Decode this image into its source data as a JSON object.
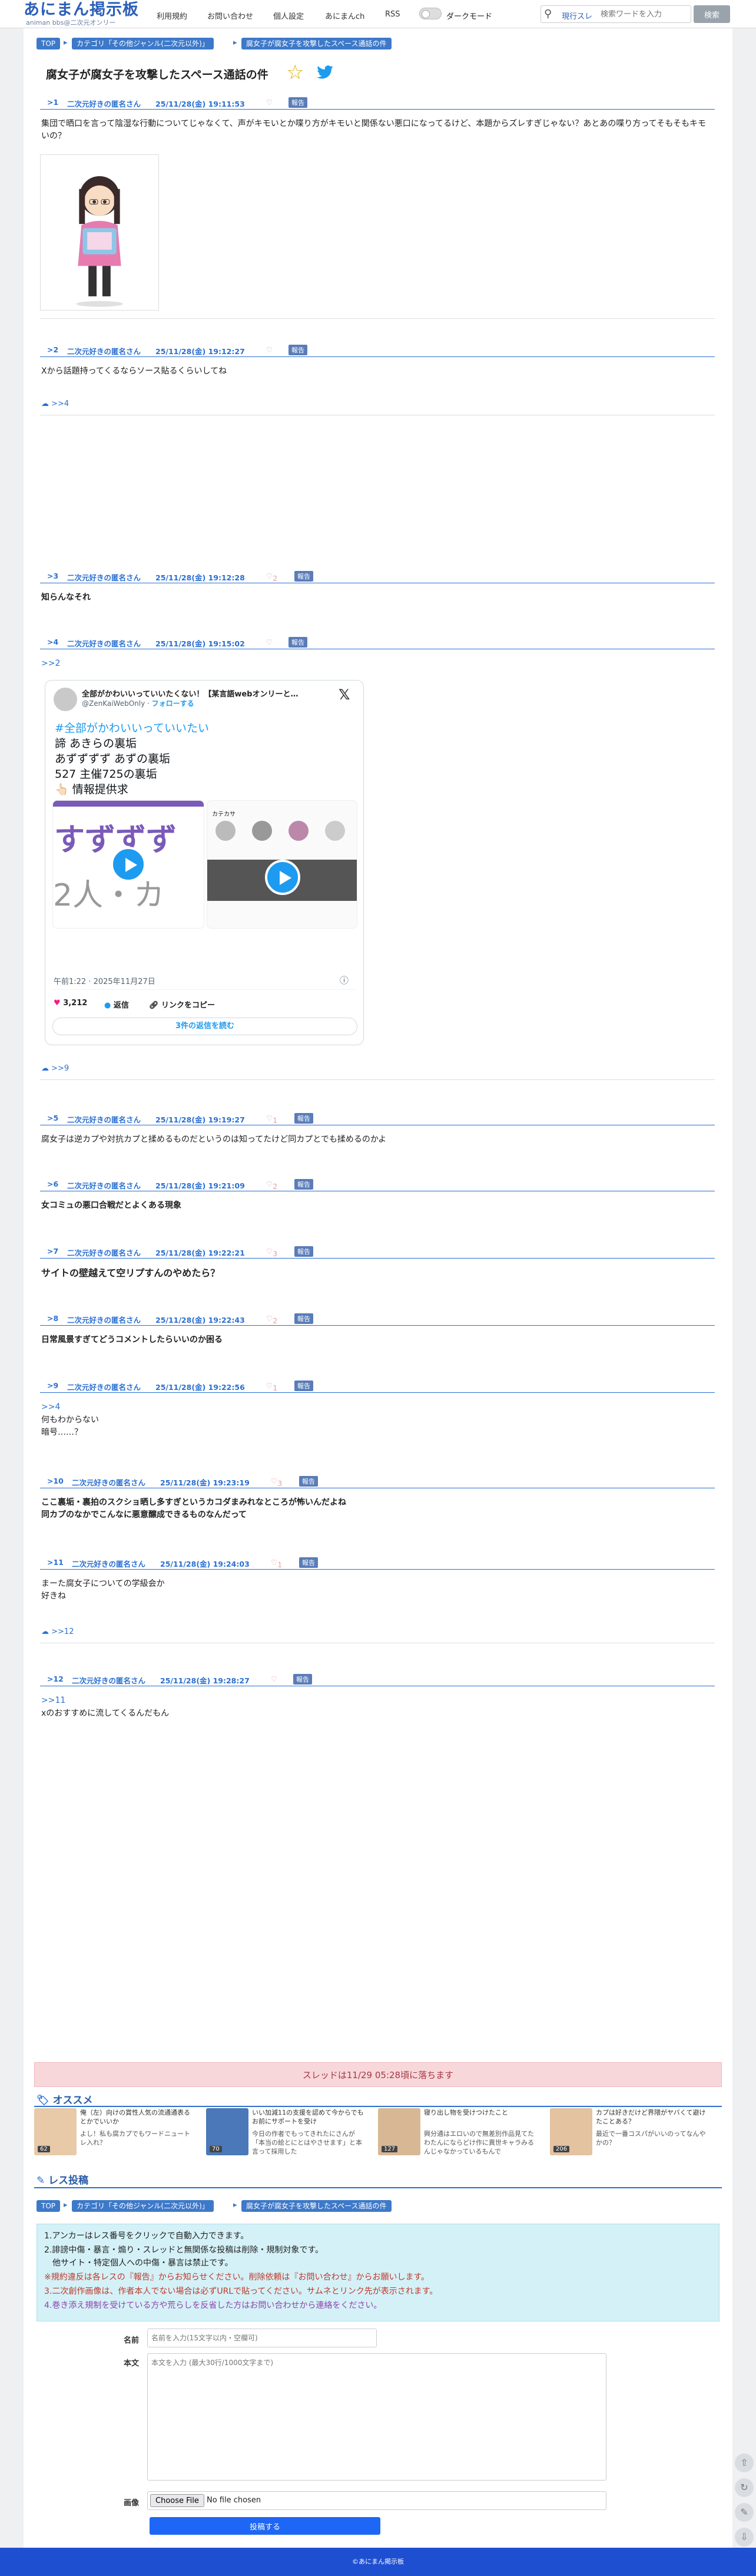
{
  "header": {
    "logo": "あにまん掲示板",
    "logo_sub": "animan bbs@二次元オンリー",
    "nav": [
      "利用規約",
      "お問い合わせ",
      "個人設定",
      "あにまんch",
      "RSS"
    ],
    "dark_mode_label": "ダークモード",
    "search_mode": "現行スレ",
    "search_placeholder": "検索ワードを入力",
    "search_button": "検索"
  },
  "breadcrumb": [
    "TOP",
    "カテゴリ「その他ジャンル(二次元以外)」",
    "腐女子が腐女子を攻撃したスペース通話の件"
  ],
  "thread_title": "腐女子が腐女子を攻撃したスペース通話の件",
  "posts": [
    {
      "num": ">1",
      "author": "二次元好きの匿名さん",
      "date": "25/11/28(金) 19:11:53",
      "likes": "",
      "report": "報告",
      "lines": [
        "集団で晒口を言って陰湿な行動についてじゃなくて、声がキモいとか喋り方がキモいと関係ない悪口になってるけど、本題からズレすぎじゃない？あとあの喋り方ってそもそもキモいの？"
      ]
    },
    {
      "num": ">2",
      "author": "二次元好きの匿名さん",
      "date": "25/11/28(金) 19:12:27",
      "likes": "",
      "report": "報告",
      "lines": [
        "Xから話題持ってくるならソース貼るくらいしてね"
      ],
      "reply": ">>4"
    },
    {
      "num": ">3",
      "author": "二次元好きの匿名さん",
      "date": "25/11/28(金) 19:12:28",
      "likes": "2",
      "report": "報告",
      "lines": [
        "知らんなそれ"
      ]
    },
    {
      "num": ">4",
      "author": "二次元好きの匿名さん",
      "date": "25/11/28(金) 19:15:02",
      "likes": "",
      "report": "報告",
      "anchor": ">>2",
      "reply": ">>9"
    },
    {
      "num": ">5",
      "author": "二次元好きの匿名さん",
      "date": "25/11/28(金) 19:19:27",
      "likes": "1",
      "report": "報告",
      "lines": [
        "腐女子は逆カプや対抗カプと揉めるものだというのは知ってたけど同カプとでも揉めるのかよ"
      ]
    },
    {
      "num": ">6",
      "author": "二次元好きの匿名さん",
      "date": "25/11/28(金) 19:21:09",
      "likes": "2",
      "report": "報告",
      "lines": [
        "女コミュの悪口合戦だとよくある現象"
      ]
    },
    {
      "num": ">7",
      "author": "二次元好きの匿名さん",
      "date": "25/11/28(金) 19:22:21",
      "likes": "3",
      "report": "報告",
      "lines": [
        "サイトの壁越えて空リプすんのやめたら？"
      ]
    },
    {
      "num": ">8",
      "author": "二次元好きの匿名さん",
      "date": "25/11/28(金) 19:22:43",
      "likes": "2",
      "report": "報告",
      "lines": [
        "日常風景すぎてどうコメントしたらいいのか困る"
      ]
    },
    {
      "num": ">9",
      "author": "二次元好きの匿名さん",
      "date": "25/11/28(金) 19:22:56",
      "likes": "1",
      "report": "報告",
      "anchor": ">>4",
      "lines": [
        "何もわからない",
        "暗号……？"
      ]
    },
    {
      "num": ">10",
      "author": "二次元好きの匿名さん",
      "date": "25/11/28(金) 19:23:19",
      "likes": "3",
      "report": "報告",
      "lines": [
        "ここ裏垢・裏拍のスクショ晒し多すぎというカコダまみれなところが怖いんだよね",
        "同カプのなかでこんなに悪意醸成できるものなんだって"
      ]
    },
    {
      "num": ">11",
      "author": "二次元好きの匿名さん",
      "date": "25/11/28(金) 19:24:03",
      "likes": "1",
      "report": "報告",
      "lines": [
        "まーた腐女子についての学級会か",
        "好きね"
      ],
      "reply": ">>12"
    },
    {
      "num": ">12",
      "author": "二次元好きの匿名さん",
      "date": "25/11/28(金) 19:28:27",
      "likes": "",
      "report": "報告",
      "anchor": ">>11",
      "lines": [
        "xのおすすめに流してくるんだもん"
      ]
    }
  ],
  "tweet": {
    "account": "全部がかわいいっていいたくない！【某言語webオンリーと…",
    "handle": "@ZenKaiWebOnly",
    "follow": "フォローする",
    "hashtag": "#全部がかわいいっていいたい",
    "lines": [
      "諦 あきらの裏垢",
      "あずずずず あずの裏垢",
      "527 主催725の裏垢",
      "👆🏻 情報提供求"
    ],
    "video_text_1": "すずずず",
    "video_text_2": "2人・カ",
    "video2_header": "カテカサ",
    "time": "午前1:22 · 2025年11月27日",
    "likes": "3,212",
    "reply": "返信",
    "copy": "リンクをコピー",
    "read_replies": "3件の返信を読む"
  },
  "expiry": "スレッドは11/29 05:28頃に落ちます",
  "recommend": {
    "title": "オススメ",
    "items": [
      {
        "title": "俺（左）向けの賞性人気の流通通表るとかでいいか",
        "sub": "よし！私も腐カプでもワードニュートレ入れ？",
        "count": "62"
      },
      {
        "title": "いい加減11の支援を認めて今からでもお前にサポートを受け",
        "sub": "今日の作者でもってきれたにさんが「本当の絵とにとはやさせます」と本言って採用した",
        "count": "70"
      },
      {
        "title": "寝り出し物を受けつけたこと",
        "sub": "興分通はエロいので無差別作品見てたわたんにならどけ作に異世キャラみるんじゃなかっているもんで",
        "count": "127"
      },
      {
        "title": "カプは好きだけど界隈がヤバくて避けたことある？",
        "sub": "最近で一番コスパがいいのってなんやかの？",
        "count": "206"
      }
    ]
  },
  "reply_section": {
    "title": "レス投稿",
    "rules": [
      "1.アンカーはレス番号をクリックで自動入力できます。",
      "2.誹謗中傷・暴言・煽り・スレッドと無関係な投稿は削除・規制対象です。",
      "　他サイト・特定個人への中傷・暴言は禁止です。",
      "※規約違反は各レスの『報告』からお知らせください。削除依頼は『お問い合わせ』からお願いします。",
      "3.二次創作画像は、作者本人でない場合は必ずURLで貼ってください。サムネとリンク先が表示されます。",
      "4.巻き添え規制を受けている方や荒らしを反省した方はお問い合わせから連絡をください。"
    ],
    "name_label": "名前",
    "name_placeholder": "名前を入力(15文字以内・空欄可)",
    "body_label": "本文",
    "body_placeholder": "本文を入力 (最大30行/1000文字まで)",
    "image_label": "画像",
    "file_button": "Choose File",
    "file_status": "No file chosen",
    "submit": "投稿する"
  },
  "footer": "©あにまん掲示板",
  "colors": {
    "accent": "#2a6fd0",
    "footer": "#1f4fd1",
    "expiry_bg": "#f8d7da",
    "rules_bg": "#d4f1f7"
  }
}
